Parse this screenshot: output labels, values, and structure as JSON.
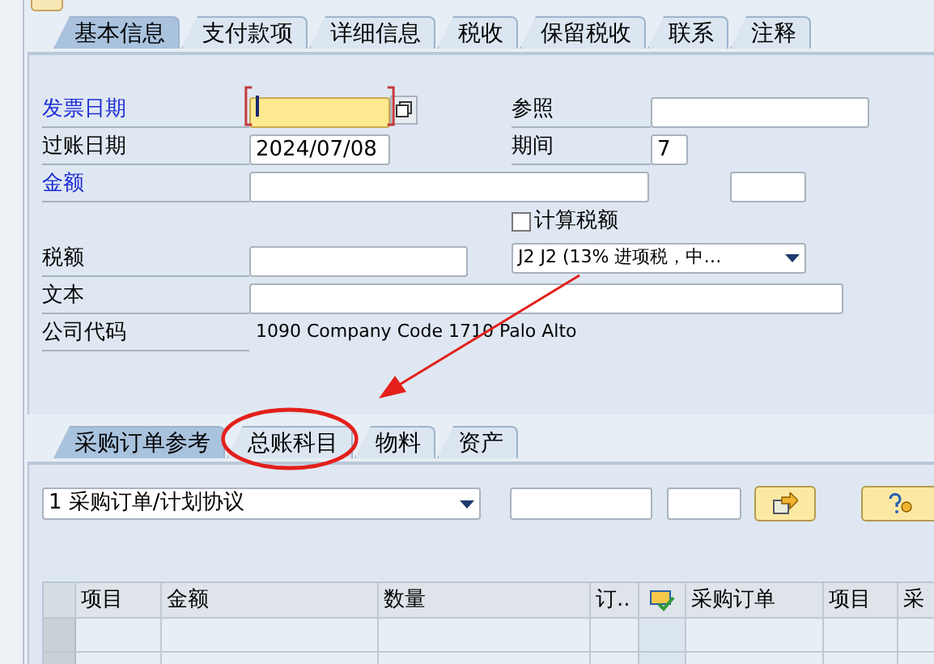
{
  "top_tabs": [
    {
      "label": "基本信息",
      "selected": true
    },
    {
      "label": "支付款项",
      "selected": false
    },
    {
      "label": "详细信息",
      "selected": false
    },
    {
      "label": "税收",
      "selected": false
    },
    {
      "label": "保留税收",
      "selected": false
    },
    {
      "label": "联系",
      "selected": false
    },
    {
      "label": "注释",
      "selected": false
    }
  ],
  "header": {
    "invoice_date": {
      "label": "发票日期",
      "link": true,
      "focused": true
    },
    "reference": {
      "label": "参照"
    },
    "posting_date": {
      "label": "过账日期",
      "link": false,
      "value": "2024/07/08"
    },
    "period": {
      "label": "期间",
      "value": "7"
    },
    "amount": {
      "label": "金额",
      "link": true
    },
    "calculate_tax": {
      "label": "计算税额",
      "checked": false
    },
    "tax_amount": {
      "label": "税额",
      "link": false
    },
    "tax_code": {
      "value": "J2 J2 (13% 进项税，中…"
    },
    "text": {
      "label": "文本",
      "link": false
    },
    "company_code": {
      "label": "公司代码",
      "value": "1090 Company Code 1710 Palo Alto"
    }
  },
  "bottom_tabs": [
    {
      "label": "采购订单参考",
      "selected": true,
      "circled": false
    },
    {
      "label": "总账科目",
      "selected": false,
      "circled": true
    },
    {
      "label": "物料",
      "selected": false,
      "circled": false
    },
    {
      "label": "资产",
      "selected": false,
      "circled": false
    }
  ],
  "reference_type": {
    "value": "1 采购订单/计划协议"
  },
  "table": {
    "columns": [
      "项目",
      "金额",
      "数量",
      "订..",
      "",
      "采购订单",
      "项目",
      "采"
    ]
  }
}
